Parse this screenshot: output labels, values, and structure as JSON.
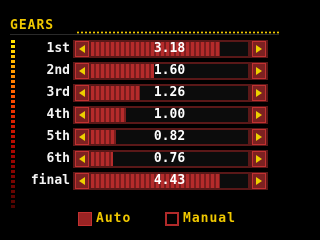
{
  "panel": {
    "title": "GEARS",
    "accent_color": "#f0c800",
    "row_color": "#5a1818",
    "arrow_color": "#ecd000"
  },
  "gears": [
    {
      "label": "1st",
      "value": "3.18",
      "bar_fraction": 0.82
    },
    {
      "label": "2nd",
      "value": "1.60",
      "bar_fraction": 0.4
    },
    {
      "label": "3rd",
      "value": "1.26",
      "bar_fraction": 0.31
    },
    {
      "label": "4th",
      "value": "1.00",
      "bar_fraction": 0.22
    },
    {
      "label": "5th",
      "value": "0.82",
      "bar_fraction": 0.16
    },
    {
      "label": "6th",
      "value": "0.76",
      "bar_fraction": 0.14
    },
    {
      "label": "final",
      "value": "4.43",
      "bar_fraction": 0.82
    }
  ],
  "mode": {
    "auto_label": "Auto",
    "manual_label": "Manual",
    "selected": "Auto"
  }
}
